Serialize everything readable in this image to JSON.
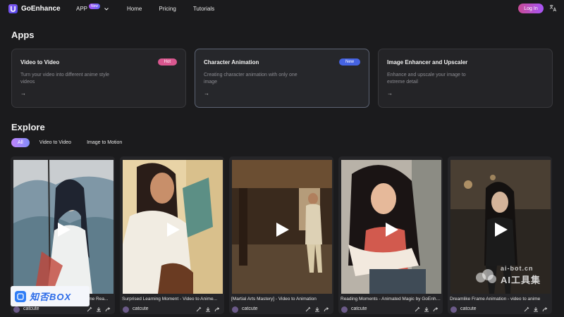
{
  "nav": {
    "brand": "GoEnhance",
    "app_label": "APP",
    "app_badge": "New",
    "links": [
      "Home",
      "Pricing",
      "Tutorials"
    ],
    "login_label": "Log In"
  },
  "apps": {
    "title": "Apps",
    "cards": [
      {
        "title": "Video to Video",
        "description": "Turn your video into different anime style videos",
        "badge": "Hot",
        "arrow": "→"
      },
      {
        "title": "Character Animation",
        "description": "Creating character animation with only one image",
        "badge": "New",
        "arrow": "→"
      },
      {
        "title": "Image Enhancer and Upscaler",
        "description": "Enhance and upscale your image to extreme detail",
        "badge": "",
        "arrow": "→"
      }
    ]
  },
  "explore": {
    "title": "Explore",
    "filters": [
      "All",
      "Video to Video",
      "Image to Motion"
    ],
    "active_filter": "All",
    "videos": [
      {
        "title": "Anime Boy Rain Scene - Video to Anime Rea...",
        "author": "catcute"
      },
      {
        "title": "Surprised Learning Moment - Video to Anime...",
        "author": "catcute"
      },
      {
        "title": "[Martial Arts Mastery] - Video to Animation",
        "author": "catcute"
      },
      {
        "title": "Reading Moments - Animated Magic by GoEnhance",
        "author": "catcute"
      },
      {
        "title": "Dreamlike Frame Animation - video to anime",
        "author": "catcute"
      }
    ]
  },
  "watermarks": {
    "left": "知否BOX",
    "right_url": "ai-bot.cn",
    "right_name": "AI工具集"
  },
  "colors": {
    "background": "#1b1b1d",
    "card": "#242427",
    "accent_pink": "#d9578f",
    "accent_blue": "#4563e2",
    "login_gradient_start": "#c74b95"
  }
}
